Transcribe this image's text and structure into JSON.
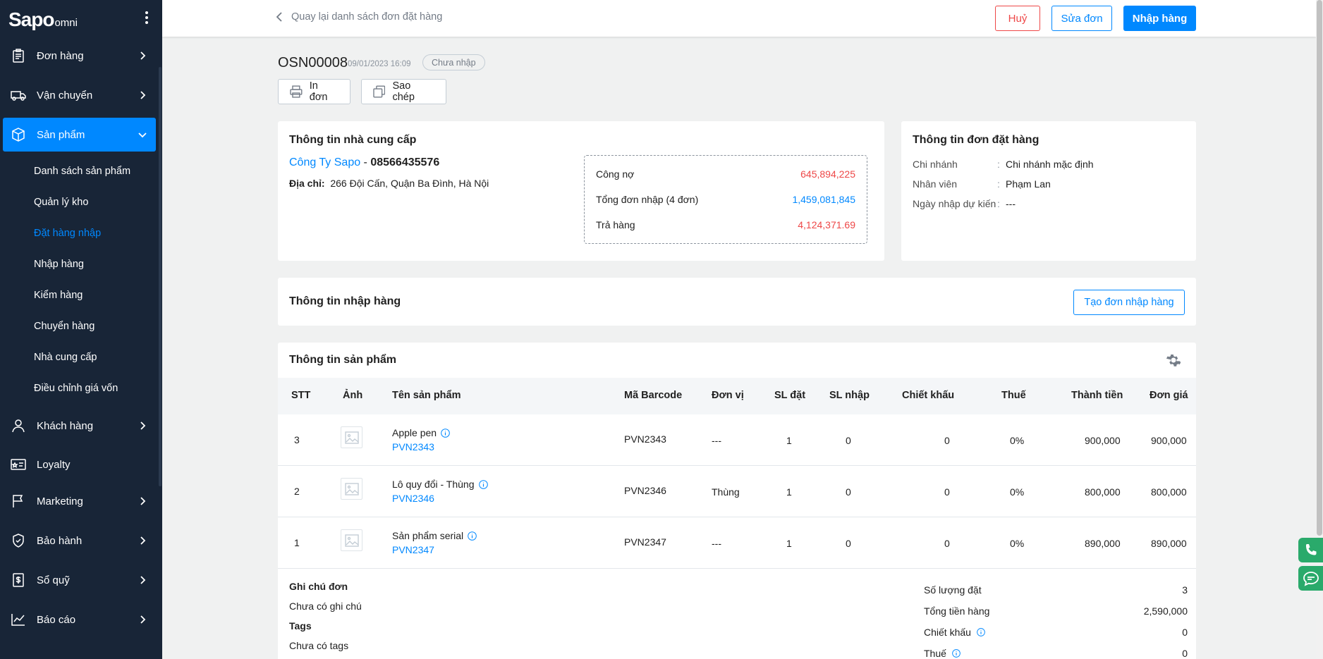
{
  "app": {
    "brand": "Sapo",
    "brand_sub": "omni"
  },
  "sidebar": {
    "items": [
      {
        "label": "Đơn hàng",
        "icon": "clipboard-icon"
      },
      {
        "label": "Vận chuyển",
        "icon": "truck-icon"
      },
      {
        "label": "Sản phẩm",
        "icon": "box-icon",
        "active": true
      },
      {
        "label": "Khách hàng",
        "icon": "user-icon"
      },
      {
        "label": "Loyalty",
        "icon": "loyalty-card-icon"
      },
      {
        "label": "Marketing",
        "icon": "flag-icon"
      },
      {
        "label": "Bảo hành",
        "icon": "shield-icon"
      },
      {
        "label": "Sổ quỹ",
        "icon": "cashbook-icon"
      },
      {
        "label": "Báo cáo",
        "icon": "chart-line-icon"
      }
    ],
    "sub_items": [
      {
        "label": "Danh sách sản phẩm"
      },
      {
        "label": "Quản lý kho"
      },
      {
        "label": "Đặt hàng nhập",
        "active": true
      },
      {
        "label": "Nhập hàng"
      },
      {
        "label": "Kiểm hàng"
      },
      {
        "label": "Chuyển hàng"
      },
      {
        "label": "Nhà cung cấp"
      },
      {
        "label": "Điều chỉnh giá vốn"
      }
    ]
  },
  "topbar": {
    "back_label": "Quay lại danh sách đơn đặt hàng",
    "cancel_label": "Huỷ",
    "edit_label": "Sửa đơn",
    "import_label": "Nhập hàng"
  },
  "order": {
    "code": "OSN00008",
    "date": "09/01/2023 16:09",
    "status": "Chưa nhập",
    "print_label": "In đơn",
    "copy_label": "Sao chép"
  },
  "supplier": {
    "title": "Thông tin nhà cung cấp",
    "name": "Công Ty Sapo",
    "separator": " - ",
    "phone": "08566435576",
    "address_label": "Địa chỉ:",
    "address": "266 Đội Cấn, Quận Ba Đình, Hà Nội",
    "debt_label": "Công nợ",
    "debt_value": "645,894,225",
    "total_orders_label": "Tổng đơn nhập (4 đơn)",
    "total_orders_value": "1,459,081,845",
    "returns_label": "Trả hàng",
    "returns_value": "4,124,371.69"
  },
  "order_info": {
    "title": "Thông tin đơn đặt hàng",
    "branch_label": "Chi nhánh",
    "branch_value": "Chi nhánh mặc định",
    "staff_label": "Nhân viên",
    "staff_value": "Phạm Lan",
    "eta_label": "Ngày nhập dự kiến",
    "eta_value": "---",
    "colon": ":"
  },
  "import_info": {
    "title": "Thông tin nhập hàng",
    "create_label": "Tạo đơn nhập hàng"
  },
  "products": {
    "title": "Thông tin sản phẩm",
    "columns": {
      "stt": "STT",
      "image": "Ảnh",
      "name": "Tên sản phẩm",
      "barcode": "Mã Barcode",
      "unit": "Đơn vị",
      "qty_ordered": "SL đặt",
      "qty_imported": "SL nhập",
      "discount": "Chiết khấu",
      "tax": "Thuế",
      "total": "Thành tiền",
      "price": "Đơn giá"
    },
    "rows": [
      {
        "stt": "3",
        "name": "Apple pen",
        "sku": "PVN2343",
        "barcode": "PVN2343",
        "unit": "---",
        "qty_ordered": "1",
        "qty_imported": "0",
        "discount": "0",
        "tax": "0%",
        "total": "900,000",
        "price": "900,000"
      },
      {
        "stt": "2",
        "name": "Lô quy đổi - Thùng",
        "sku": "PVN2346",
        "barcode": "PVN2346",
        "unit": "Thùng",
        "qty_ordered": "1",
        "qty_imported": "0",
        "discount": "0",
        "tax": "0%",
        "total": "800,000",
        "price": "800,000"
      },
      {
        "stt": "1",
        "name": "Sản phẩm serial",
        "sku": "PVN2347",
        "barcode": "PVN2347",
        "unit": "---",
        "qty_ordered": "1",
        "qty_imported": "0",
        "discount": "0",
        "tax": "0%",
        "total": "890,000",
        "price": "890,000"
      }
    ]
  },
  "notes": {
    "note_title": "Ghi chú đơn",
    "note_value": "Chưa có ghi chú",
    "tags_title": "Tags",
    "tags_value": "Chưa có tags"
  },
  "summary": {
    "qty_label": "Số lượng đặt",
    "qty_value": "3",
    "subtotal_label": "Tổng tiền hàng",
    "subtotal_value": "2,590,000",
    "discount_label": "Chiết khấu",
    "discount_value": "0",
    "tax_label": "Thuế",
    "tax_value": "0"
  },
  "colors": {
    "primary": "#0088ff",
    "danger": "#ee4747",
    "sidebar": "#182537",
    "contact": "#2aaa6b"
  }
}
